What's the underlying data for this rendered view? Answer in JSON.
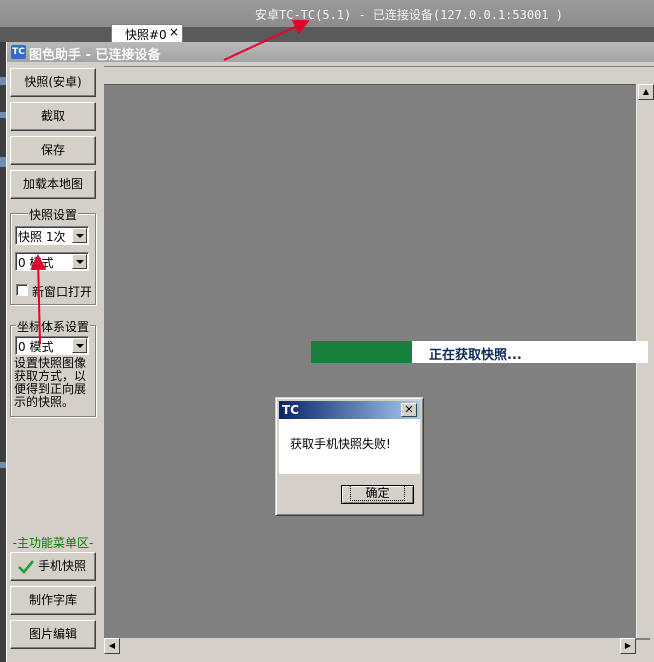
{
  "top_bar": {
    "title": "安卓TC-TC(5.1) - 已连接设备(127.0.0.1:53001 )"
  },
  "window": {
    "app_icon_text": "TC",
    "title": "图色助手 - 已连接设备"
  },
  "left_panel": {
    "buttons": [
      "快照(安卓)",
      "截取",
      "保存",
      "加载本地图"
    ],
    "snapshot_settings": {
      "label": "快照设置",
      "count_value": "快照 1次",
      "mode_value": "0 模式",
      "new_window_label": "新窗口打开",
      "new_window_checked": false
    },
    "coord_settings": {
      "label": "坐标体系设置",
      "mode_value": "0 模式",
      "description": "设置快照图像获取方式，以便得到正向展示的快照。"
    },
    "main_menu_label": "-主功能菜单区-",
    "menu_buttons": [
      "手机快照",
      "制作字库",
      "图片编辑"
    ]
  },
  "tabs": [
    {
      "label": "快照#0",
      "close": "×"
    }
  ],
  "progress": {
    "text": "正在获取快照...",
    "fraction": 0.3
  },
  "dialog": {
    "title": "TC",
    "close": "✕",
    "message": "获取手机快照失败!",
    "ok_label": "确定"
  },
  "colors": {
    "canvas": "#808080",
    "progress_fill": "#16803c",
    "annotation_arrow": "#e4002b",
    "menu_label": "#008000"
  }
}
